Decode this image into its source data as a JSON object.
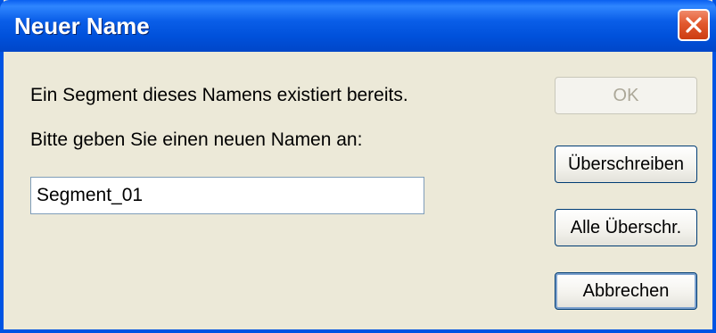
{
  "window": {
    "title": "Neuer Name"
  },
  "dialog": {
    "message_line1": "Ein Segment dieses Namens existiert bereits.",
    "message_line2": "Bitte geben Sie einen neuen Namen an:",
    "name_value": "Segment_01"
  },
  "buttons": {
    "ok": "OK",
    "overwrite": "Überschreiben",
    "overwrite_all": "Alle Überschr.",
    "cancel": "Abbrechen"
  },
  "icons": {
    "close": "close-icon"
  },
  "colors": {
    "titlebar": "#0054E3",
    "close": "#E2592E",
    "background": "#ECE9D8"
  }
}
